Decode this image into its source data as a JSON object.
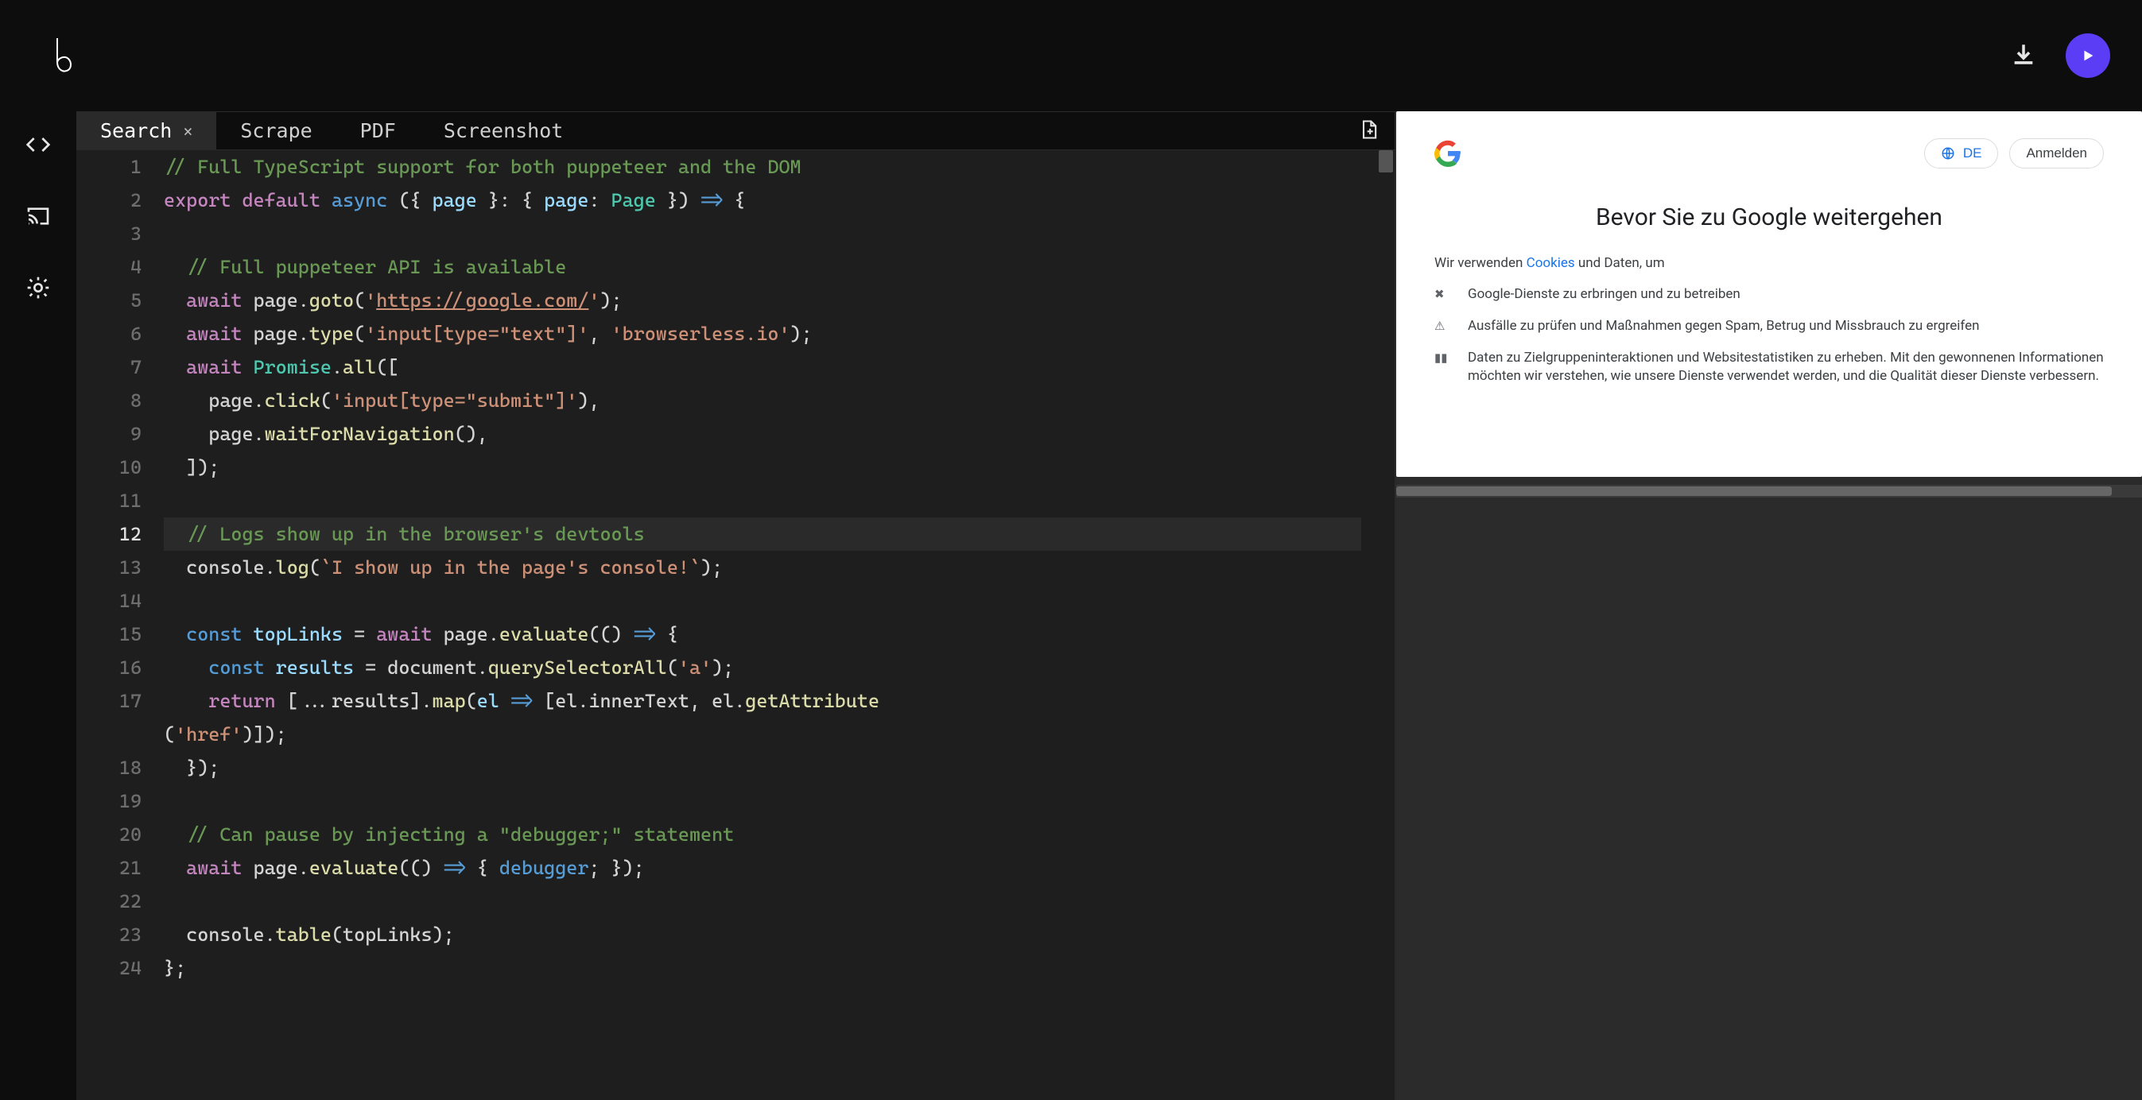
{
  "tabs": [
    {
      "label": "Search",
      "active": true,
      "closable": true
    },
    {
      "label": "Scrape",
      "active": false,
      "closable": false
    },
    {
      "label": "PDF",
      "active": false,
      "closable": false
    },
    {
      "label": "Screenshot",
      "active": false,
      "closable": false
    }
  ],
  "active_line": 12,
  "code_lines": [
    {
      "n": 1,
      "segments": [
        {
          "t": "// Full TypeScript support for both puppeteer and the DOM",
          "c": "c-comment"
        }
      ]
    },
    {
      "n": 2,
      "segments": [
        {
          "t": "export default",
          "c": "c-kw2"
        },
        {
          "t": " ",
          "c": ""
        },
        {
          "t": "async",
          "c": "c-kw"
        },
        {
          "t": " ({ ",
          "c": ""
        },
        {
          "t": "page",
          "c": "c-var"
        },
        {
          "t": " }: { ",
          "c": ""
        },
        {
          "t": "page",
          "c": "c-var"
        },
        {
          "t": ": ",
          "c": ""
        },
        {
          "t": "Page",
          "c": "c-type"
        },
        {
          "t": " }) ",
          "c": ""
        },
        {
          "t": "=>",
          "c": "c-kw"
        },
        {
          "t": " {",
          "c": ""
        }
      ]
    },
    {
      "n": 3,
      "segments": [
        {
          "t": "",
          "c": ""
        }
      ]
    },
    {
      "n": 4,
      "segments": [
        {
          "t": "  ",
          "c": ""
        },
        {
          "t": "// Full puppeteer API is available",
          "c": "c-comment"
        }
      ]
    },
    {
      "n": 5,
      "segments": [
        {
          "t": "  ",
          "c": ""
        },
        {
          "t": "await",
          "c": "c-kw2"
        },
        {
          "t": " page.",
          "c": ""
        },
        {
          "t": "goto",
          "c": "c-fn"
        },
        {
          "t": "(",
          "c": ""
        },
        {
          "t": "'",
          "c": "c-str"
        },
        {
          "t": "https://google.com/",
          "c": "c-str-u"
        },
        {
          "t": "'",
          "c": "c-str"
        },
        {
          "t": ");",
          "c": ""
        }
      ]
    },
    {
      "n": 6,
      "segments": [
        {
          "t": "  ",
          "c": ""
        },
        {
          "t": "await",
          "c": "c-kw2"
        },
        {
          "t": " page.",
          "c": ""
        },
        {
          "t": "type",
          "c": "c-fn"
        },
        {
          "t": "(",
          "c": ""
        },
        {
          "t": "'input[type=\"text\"]'",
          "c": "c-str"
        },
        {
          "t": ", ",
          "c": ""
        },
        {
          "t": "'browserless.io'",
          "c": "c-str"
        },
        {
          "t": ");",
          "c": ""
        }
      ]
    },
    {
      "n": 7,
      "segments": [
        {
          "t": "  ",
          "c": ""
        },
        {
          "t": "await",
          "c": "c-kw2"
        },
        {
          "t": " ",
          "c": ""
        },
        {
          "t": "Promise",
          "c": "c-type"
        },
        {
          "t": ".",
          "c": ""
        },
        {
          "t": "all",
          "c": "c-fn"
        },
        {
          "t": "([",
          "c": ""
        }
      ]
    },
    {
      "n": 8,
      "segments": [
        {
          "t": "    page.",
          "c": ""
        },
        {
          "t": "click",
          "c": "c-fn"
        },
        {
          "t": "(",
          "c": ""
        },
        {
          "t": "'input[type=\"submit\"]'",
          "c": "c-str"
        },
        {
          "t": "),",
          "c": ""
        }
      ]
    },
    {
      "n": 9,
      "segments": [
        {
          "t": "    page.",
          "c": ""
        },
        {
          "t": "waitForNavigation",
          "c": "c-fn"
        },
        {
          "t": "(),",
          "c": ""
        }
      ]
    },
    {
      "n": 10,
      "segments": [
        {
          "t": "  ]);",
          "c": ""
        }
      ]
    },
    {
      "n": 11,
      "segments": [
        {
          "t": "",
          "c": ""
        }
      ]
    },
    {
      "n": 12,
      "segments": [
        {
          "t": "  ",
          "c": ""
        },
        {
          "t": "// Logs show up in the browser's devtools",
          "c": "c-comment"
        }
      ]
    },
    {
      "n": 13,
      "segments": [
        {
          "t": "  console.",
          "c": ""
        },
        {
          "t": "log",
          "c": "c-fn"
        },
        {
          "t": "(",
          "c": ""
        },
        {
          "t": "`I show up in the page's console!`",
          "c": "c-tmpl"
        },
        {
          "t": ");",
          "c": ""
        }
      ]
    },
    {
      "n": 14,
      "segments": [
        {
          "t": "",
          "c": ""
        }
      ]
    },
    {
      "n": 15,
      "segments": [
        {
          "t": "  ",
          "c": ""
        },
        {
          "t": "const",
          "c": "c-kw"
        },
        {
          "t": " ",
          "c": ""
        },
        {
          "t": "topLinks",
          "c": "c-var"
        },
        {
          "t": " = ",
          "c": ""
        },
        {
          "t": "await",
          "c": "c-kw2"
        },
        {
          "t": " page.",
          "c": ""
        },
        {
          "t": "evaluate",
          "c": "c-fn"
        },
        {
          "t": "(() ",
          "c": ""
        },
        {
          "t": "=>",
          "c": "c-kw"
        },
        {
          "t": " {",
          "c": ""
        }
      ]
    },
    {
      "n": 16,
      "segments": [
        {
          "t": "    ",
          "c": ""
        },
        {
          "t": "const",
          "c": "c-kw"
        },
        {
          "t": " ",
          "c": ""
        },
        {
          "t": "results",
          "c": "c-var"
        },
        {
          "t": " = document.",
          "c": ""
        },
        {
          "t": "querySelectorAll",
          "c": "c-fn"
        },
        {
          "t": "(",
          "c": ""
        },
        {
          "t": "'a'",
          "c": "c-str"
        },
        {
          "t": ");",
          "c": ""
        }
      ]
    },
    {
      "n": 17,
      "segments": [
        {
          "t": "    ",
          "c": ""
        },
        {
          "t": "return",
          "c": "c-kw2"
        },
        {
          "t": " [...results].",
          "c": ""
        },
        {
          "t": "map",
          "c": "c-fn"
        },
        {
          "t": "(",
          "c": ""
        },
        {
          "t": "el",
          "c": "c-var"
        },
        {
          "t": " ",
          "c": ""
        },
        {
          "t": "=>",
          "c": "c-kw"
        },
        {
          "t": " [el.innerText, el.",
          "c": ""
        },
        {
          "t": "getAttribute",
          "c": "c-fn"
        }
      ]
    },
    {
      "n": null,
      "segments": [
        {
          "t": "(",
          "c": ""
        },
        {
          "t": "'href'",
          "c": "c-str"
        },
        {
          "t": ")]);",
          "c": ""
        }
      ]
    },
    {
      "n": 18,
      "segments": [
        {
          "t": "  });",
          "c": ""
        }
      ]
    },
    {
      "n": 19,
      "segments": [
        {
          "t": "",
          "c": ""
        }
      ]
    },
    {
      "n": 20,
      "segments": [
        {
          "t": "  ",
          "c": ""
        },
        {
          "t": "// Can pause by injecting a \"debugger;\" statement",
          "c": "c-comment"
        }
      ]
    },
    {
      "n": 21,
      "segments": [
        {
          "t": "  ",
          "c": ""
        },
        {
          "t": "await",
          "c": "c-kw2"
        },
        {
          "t": " page.",
          "c": ""
        },
        {
          "t": "evaluate",
          "c": "c-fn"
        },
        {
          "t": "(() ",
          "c": ""
        },
        {
          "t": "=>",
          "c": "c-kw"
        },
        {
          "t": " { ",
          "c": ""
        },
        {
          "t": "debugger",
          "c": "c-dbg"
        },
        {
          "t": "; });",
          "c": ""
        }
      ]
    },
    {
      "n": 22,
      "segments": [
        {
          "t": "",
          "c": ""
        }
      ]
    },
    {
      "n": 23,
      "segments": [
        {
          "t": "  console.",
          "c": ""
        },
        {
          "t": "table",
          "c": "c-fn"
        },
        {
          "t": "(topLinks);",
          "c": ""
        }
      ]
    },
    {
      "n": 24,
      "segments": [
        {
          "t": "};",
          "c": ""
        }
      ]
    }
  ],
  "preview": {
    "lang_label": "DE",
    "signin_label": "Anmelden",
    "title": "Bevor Sie zu Google weitergehen",
    "intro_prefix": "Wir verwenden ",
    "intro_link": "Cookies",
    "intro_suffix": " und Daten, um",
    "items": [
      {
        "icon": "✖",
        "text": "Google-Dienste zu erbringen und zu betreiben"
      },
      {
        "icon": "⚠",
        "text": "Ausfälle zu prüfen und Maßnahmen gegen Spam, Betrug und Missbrauch zu ergreifen"
      },
      {
        "icon": "▮▮",
        "text": "Daten zu Zielgruppeninteraktionen und Websitestatistiken zu erheben. Mit den gewonnenen Informationen möchten wir verstehen, wie unsere Dienste verwendet werden, und die Qualität dieser Dienste verbessern."
      }
    ]
  }
}
